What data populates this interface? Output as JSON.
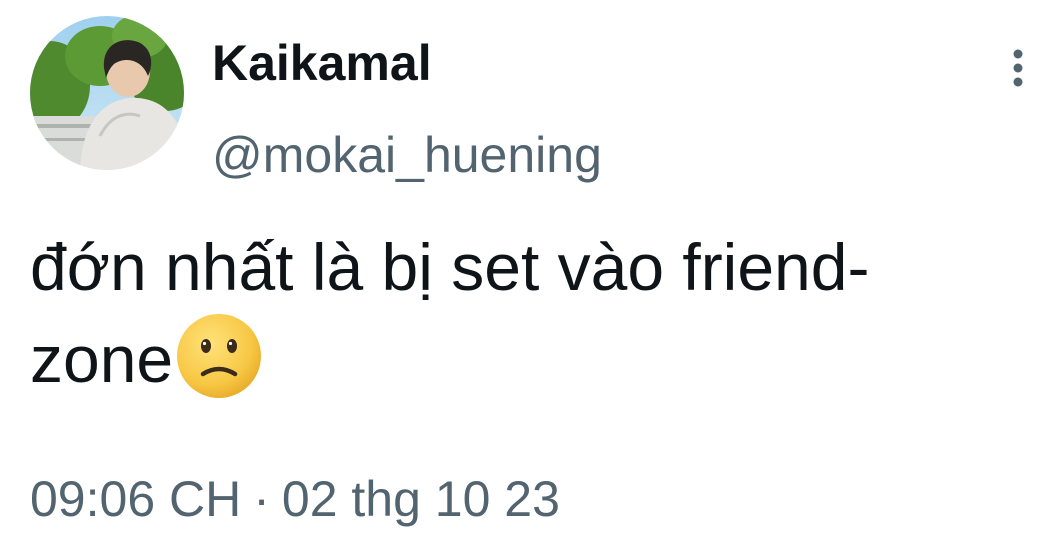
{
  "author": {
    "display_name": "Kaikamal",
    "handle": "@mokai_huening"
  },
  "tweet": {
    "text_line1": "đớn nhất là bị set vào friend-",
    "text_line2": "zone",
    "emoji": "slightly-frowning-face"
  },
  "meta": {
    "time": "09:06 CH",
    "separator": "·",
    "date": "02 thg 10 23"
  },
  "icons": {
    "more": "more-vertical-icon"
  },
  "colors": {
    "primary_text": "#0f1419",
    "secondary_text": "#536471",
    "emoji_face": "#f7c744"
  }
}
